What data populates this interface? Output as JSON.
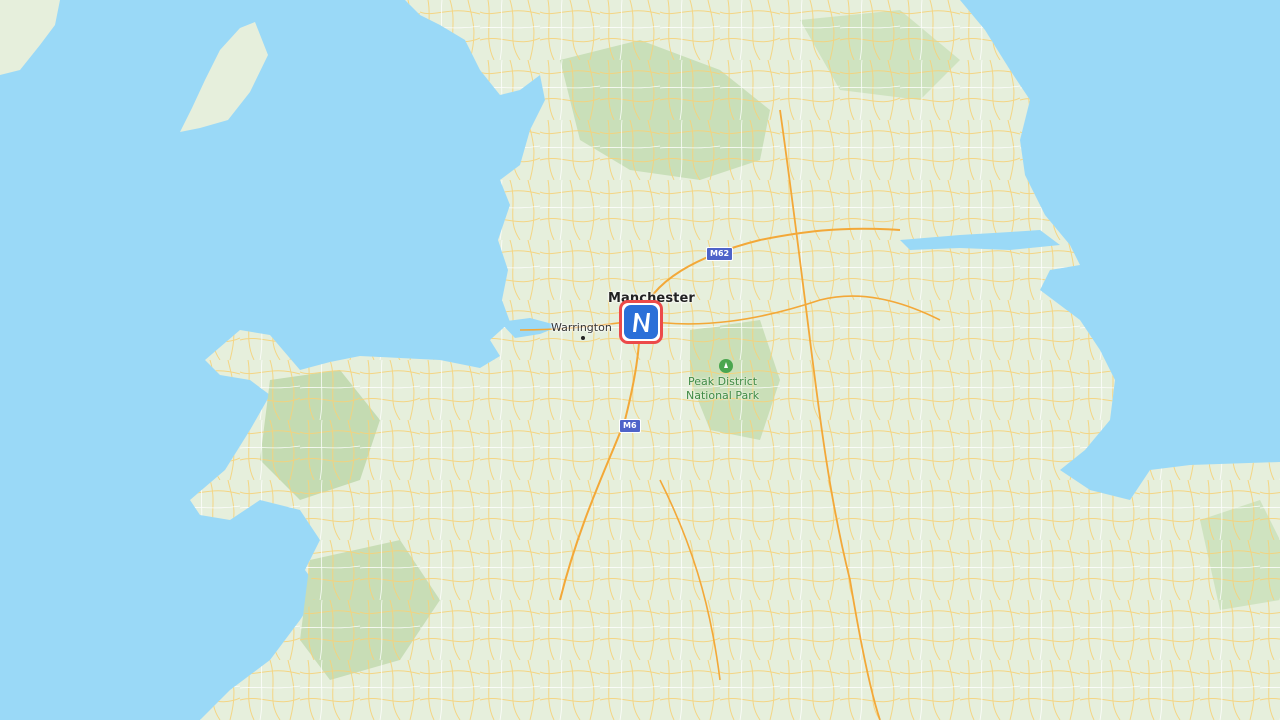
{
  "map": {
    "places": {
      "manchester": "Manchester",
      "warrington": "Warrington"
    },
    "park": {
      "line1": "Peak District",
      "line2": "National Park"
    },
    "roads": {
      "m62": "M62",
      "m6": "M6"
    },
    "marker": {
      "icon": "n-logo-icon",
      "border_color": "#ec4a4a",
      "fill_color": "#2b6fd8"
    },
    "colors": {
      "water": "#9ad9f7",
      "land": "#e6efdc",
      "hills": "#c9dfb9",
      "motorway": "#f3b34a",
      "road": "#f7d77b"
    }
  }
}
